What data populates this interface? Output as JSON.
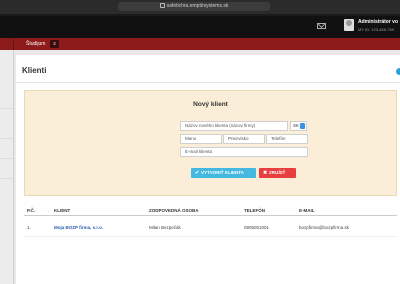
{
  "browser": {
    "url": "safetichra.emptirsystems.sk"
  },
  "header": {
    "mail_icon": "envelope-icon",
    "user_name": "Administrátor vo",
    "user_id": "MY ID: 123-456-789"
  },
  "subnav": {
    "study_label": "Študijum",
    "study_count": "2"
  },
  "page": {
    "title": "Klienti"
  },
  "new_client": {
    "title": "Nový klient",
    "name_placeholder": "Názov nového klienta (názov firmy)",
    "lang_value": "SK",
    "first_name_placeholder": "Meno",
    "last_name_placeholder": "Priezvisko",
    "phone_placeholder": "Telefón",
    "email_placeholder": "E-mail klienta",
    "create_label": "VYTVORIŤ KLIENTA",
    "cancel_label": "ZRUŠIŤ"
  },
  "table": {
    "headers": [
      "P.Č.",
      "KLIENT",
      "ZODPOVEDNÁ OSOBA",
      "TELEFÓN",
      "E-MAIL"
    ],
    "rows": [
      {
        "num": "1.",
        "client": "Moja BOZP firma, s.r.o.",
        "person": "Milan Bezpečák",
        "phone": "0905001001",
        "email": "bozpfirma@bozpfirma.sk"
      }
    ]
  }
}
